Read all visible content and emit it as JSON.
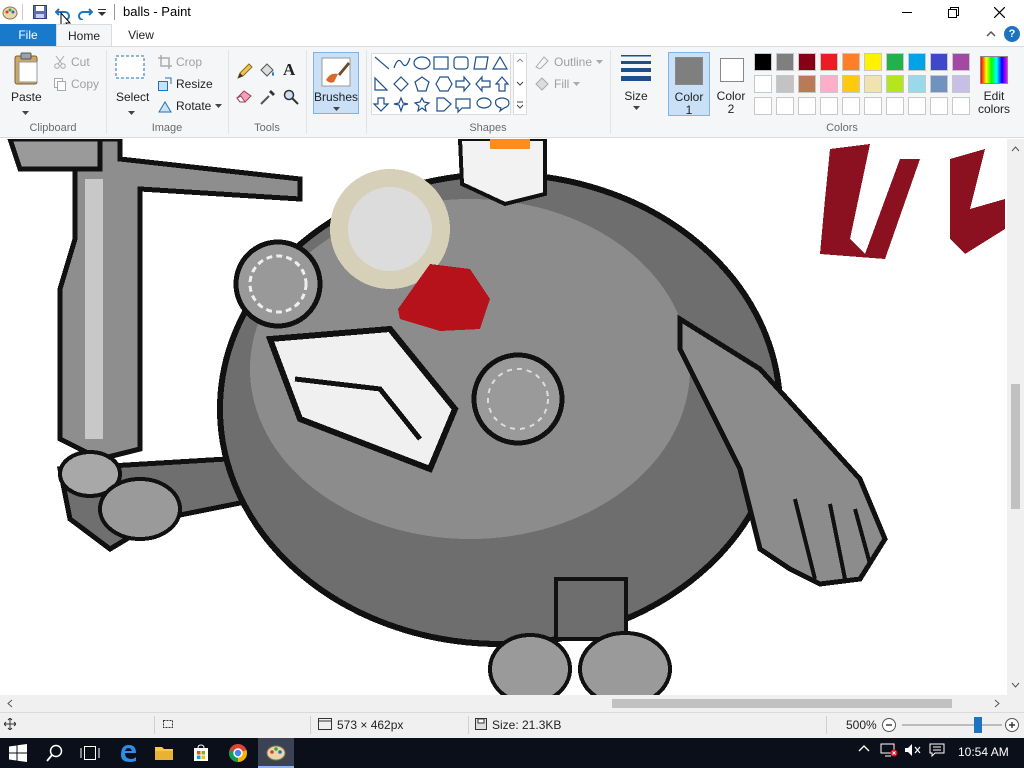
{
  "window": {
    "title": "balls - Paint"
  },
  "tabs": {
    "file": "File",
    "home": "Home",
    "view": "View"
  },
  "clipboard": {
    "paste": "Paste",
    "cut": "Cut",
    "copy": "Copy",
    "group": "Clipboard"
  },
  "image": {
    "select": "Select",
    "crop": "Crop",
    "resize": "Resize",
    "rotate": "Rotate",
    "group": "Image"
  },
  "tools": {
    "group": "Tools"
  },
  "brushes": {
    "label": "Brushes"
  },
  "shapes": {
    "outline": "Outline",
    "fill": "Fill",
    "group": "Shapes"
  },
  "size": {
    "label": "Size"
  },
  "colors": {
    "color1": "Color",
    "color1_num": "1",
    "color2": "Color",
    "color2_num": "2",
    "edit": "Edit",
    "edit2": "colors",
    "group": "Colors",
    "color1_value": "#7f7f7f",
    "color2_value": "#ffffff",
    "palette_row1": [
      "#000000",
      "#7f7f7f",
      "#880015",
      "#ed1c24",
      "#ff7f27",
      "#fff200",
      "#22b14c",
      "#00a2e8",
      "#3f48cc",
      "#a349a4"
    ],
    "palette_row2": [
      "#ffffff",
      "#c3c3c3",
      "#b97a57",
      "#ffaec9",
      "#ffc90e",
      "#efe4b0",
      "#b5e61d",
      "#99d9ea",
      "#7092be",
      "#c8bfe7"
    ]
  },
  "status": {
    "dimensions": "573 × 462px",
    "size": "Size: 21.3KB",
    "zoom": "500%",
    "zoom_fraction": 0.78
  },
  "taskbar": {
    "time": "10:54 AM"
  }
}
